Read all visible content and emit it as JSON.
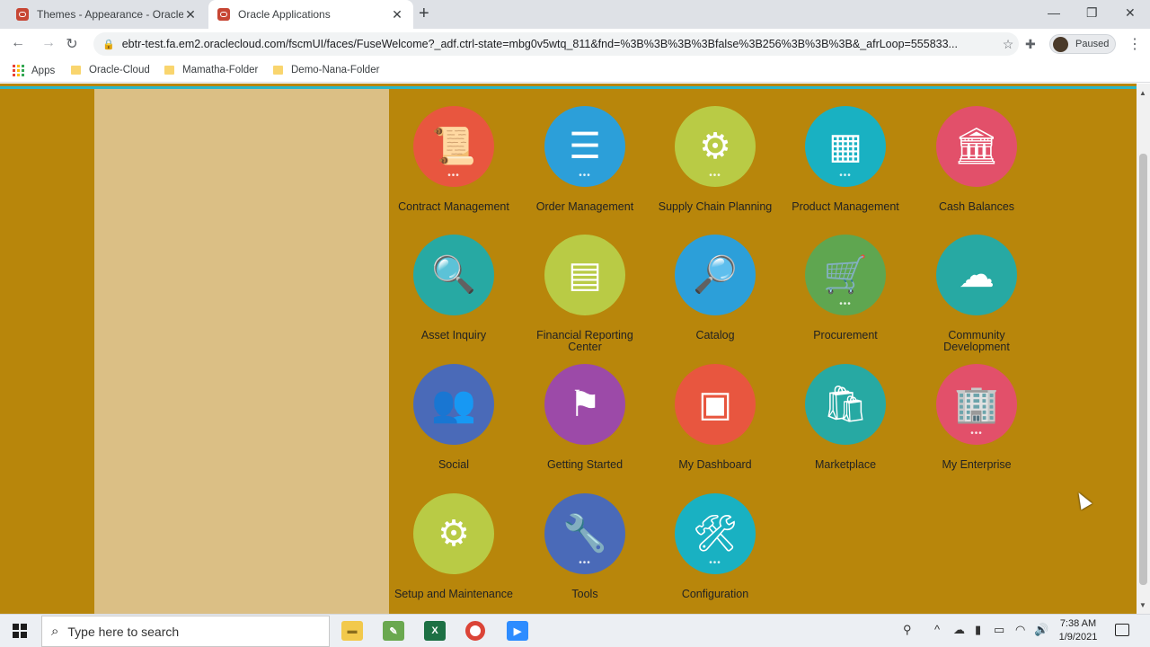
{
  "browser": {
    "tabs": [
      {
        "title": "Themes - Appearance - Oracle Ap"
      },
      {
        "title": "Oracle Applications"
      }
    ],
    "url": "ebtr-test.fa.em2.oraclecloud.com/fscmUI/faces/FuseWelcome?_adf.ctrl-state=mbg0v5wtq_811&fnd=%3B%3B%3B%3Bfalse%3B256%3B%3B%3B&_afrLoop=555833...",
    "profile_label": "Paused",
    "bookmarks": [
      {
        "label": "Apps"
      },
      {
        "label": "Oracle-Cloud"
      },
      {
        "label": "Mamatha-Folder"
      },
      {
        "label": "Demo-Nana-Folder"
      }
    ]
  },
  "springboard": {
    "tiles": [
      {
        "label": "Contract Management",
        "color": "#e8563f",
        "icon": "contract-scroll-icon",
        "glyph": "📜",
        "more": true
      },
      {
        "label": "Order Management",
        "color": "#2c9fd9",
        "icon": "list-document-icon",
        "glyph": "☰",
        "more": true
      },
      {
        "label": "Supply Chain Planning",
        "color": "#b9cb45",
        "icon": "hierarchy-pencil-icon",
        "glyph": "⚙",
        "more": true
      },
      {
        "label": "Product Management",
        "color": "#19b1c2",
        "icon": "boxes-icon",
        "glyph": "▦",
        "more": true
      },
      {
        "label": "Cash Balances",
        "color": "#e2506a",
        "icon": "bank-icon",
        "glyph": "🏛",
        "more": false
      },
      {
        "label": "Asset Inquiry",
        "color": "#27a9a3",
        "icon": "asset-search-icon",
        "glyph": "🔍",
        "more": false
      },
      {
        "label": "Financial Reporting Center",
        "color": "#b9cb45",
        "icon": "report-icon",
        "glyph": "▤",
        "more": false
      },
      {
        "label": "Catalog",
        "color": "#2c9fd9",
        "icon": "catalog-search-icon",
        "glyph": "🔎",
        "more": false
      },
      {
        "label": "Procurement",
        "color": "#5fa650",
        "icon": "cart-icon",
        "glyph": "🛒",
        "more": true
      },
      {
        "label": "Community Development",
        "color": "#27a9a3",
        "icon": "cloud-city-icon",
        "glyph": "☁",
        "more": false
      },
      {
        "label": "Social",
        "color": "#4a6ab8",
        "icon": "people-network-icon",
        "glyph": "👥",
        "more": false
      },
      {
        "label": "Getting Started",
        "color": "#9c4aa8",
        "icon": "flag-icon",
        "glyph": "⚑",
        "more": false
      },
      {
        "label": "My Dashboard",
        "color": "#e8563f",
        "icon": "dashboard-icon",
        "glyph": "▣",
        "more": false
      },
      {
        "label": "Marketplace",
        "color": "#27a9a3",
        "icon": "shopping-bag-icon",
        "glyph": "🛍",
        "more": false
      },
      {
        "label": "My Enterprise",
        "color": "#e2506a",
        "icon": "building-icon",
        "glyph": "🏢",
        "more": true
      },
      {
        "label": "Setup and Maintenance",
        "color": "#b9cb45",
        "icon": "gears-icon",
        "glyph": "⚙",
        "more": false
      },
      {
        "label": "Tools",
        "color": "#4a6ab8",
        "icon": "wrench-hammer-icon",
        "glyph": "🔧",
        "more": true
      },
      {
        "label": "Configuration",
        "color": "#19b1c2",
        "icon": "config-wrench-icon",
        "glyph": "🛠",
        "more": true
      }
    ]
  },
  "taskbar": {
    "search_placeholder": "Type here to search",
    "time": "7:38 AM",
    "date": "1/9/2021"
  }
}
